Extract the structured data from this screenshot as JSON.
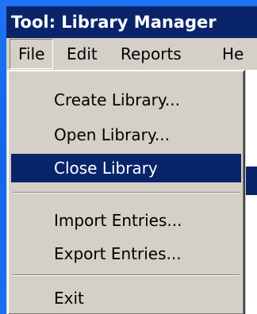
{
  "window": {
    "title": "Tool: Library Manager"
  },
  "menubar": {
    "items": [
      {
        "label": "File"
      },
      {
        "label": "Edit"
      },
      {
        "label": "Reports"
      },
      {
        "label": "He"
      }
    ]
  },
  "file_menu": {
    "items": [
      {
        "label": "Create Library..."
      },
      {
        "label": "Open Library..."
      },
      {
        "label": "Close Library"
      },
      {
        "label": "Import Entries..."
      },
      {
        "label": "Export Entries..."
      },
      {
        "label": "Exit"
      }
    ],
    "highlighted_item": "Close Library"
  },
  "colors": {
    "desktop_blue": "#1c6ef2",
    "title_bar": "#0a246a",
    "menu_face": "#d4d0c8",
    "highlight": "#0a246a",
    "highlight_text": "#ffffff"
  }
}
